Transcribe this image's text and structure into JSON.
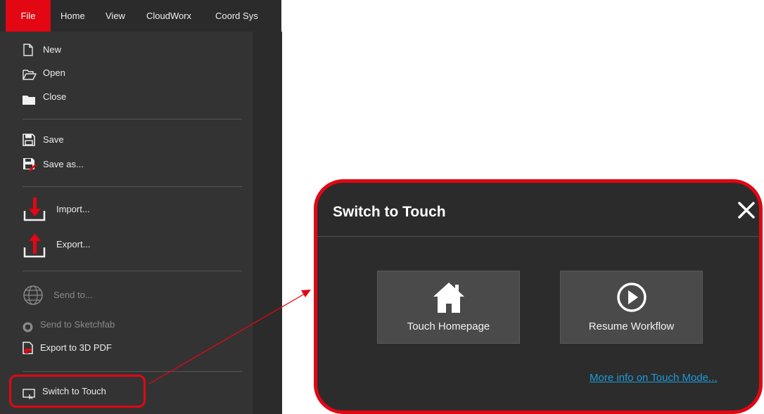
{
  "menubar": {
    "tabs": [
      {
        "label": "File"
      },
      {
        "label": "Home"
      },
      {
        "label": "View"
      },
      {
        "label": "CloudWorx"
      },
      {
        "label": "Coord Sys"
      }
    ]
  },
  "file_menu": {
    "new": "New",
    "open": "Open",
    "close": "Close",
    "save": "Save",
    "save_as": "Save as...",
    "import": "Import...",
    "export": "Export...",
    "send_to": "Send to...",
    "send_to_sketchfab": "Send to Sketchfab",
    "export_3d_pdf": "Export to 3D PDF",
    "switch_to_touch": "Switch to Touch"
  },
  "dialog": {
    "title": "Switch to Touch",
    "touch_homepage": "Touch Homepage",
    "resume_workflow": "Resume Workflow",
    "more_info_link": "More info on Touch Mode..."
  },
  "colors": {
    "accent": "#e30613",
    "link": "#1a9bdb",
    "panel_bg": "#333333",
    "dialog_bg": "#2c2c2c"
  }
}
